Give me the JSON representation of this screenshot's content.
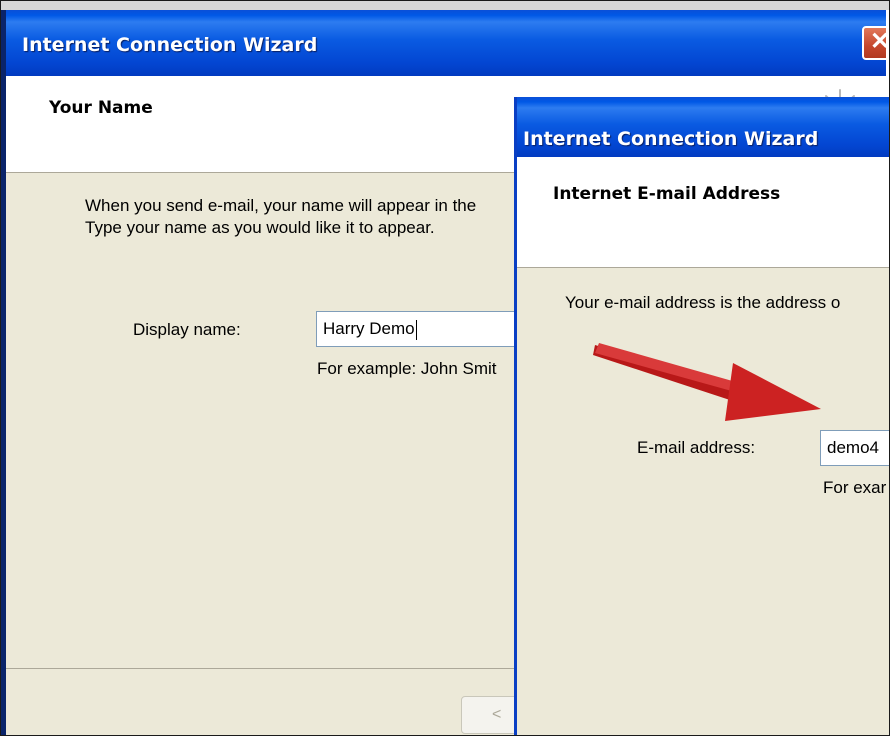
{
  "back_window": {
    "title": "Internet Connection Wizard",
    "close_glyph": "✕",
    "header_title": "Your Name",
    "intro_line1": "When you send e-mail, your name will appear in the",
    "intro_line2": "Type your name as you would like it to appear.",
    "display_name_label": "Display name:",
    "display_name_value": "Harry Demo",
    "example_text": "For example: John Smit",
    "back_button": "<",
    "icons": [
      "close-icon",
      "wizard-sparkle-icon"
    ]
  },
  "front_window": {
    "title": "Internet Connection Wizard",
    "header_title": "Internet E-mail Address",
    "intro": "Your e-mail address is the address o",
    "email_label": "E-mail address:",
    "email_value": "demo4",
    "example_text": "For exar"
  },
  "annotation": {
    "arrow_color": "#cc2222",
    "icon": "red-arrow-icon"
  },
  "colors": {
    "titlebar_blue": "#0058e6",
    "window_body": "#ece9d8",
    "input_border": "#7f9db9",
    "close_red": "#c5472d"
  }
}
